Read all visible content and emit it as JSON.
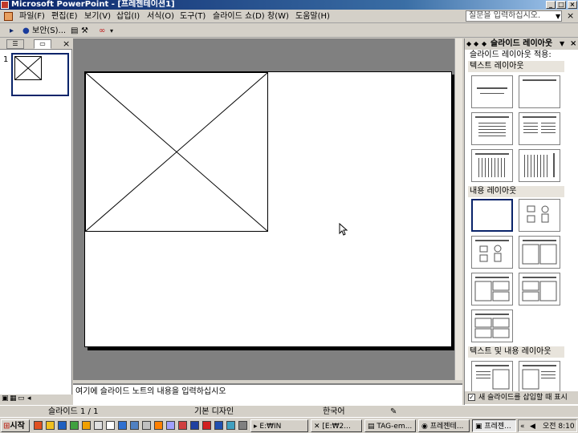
{
  "window": {
    "title": "Microsoft PowerPoint - [프레젠테이션1]",
    "min": "_",
    "max": "□",
    "close": "×"
  },
  "menu": {
    "items": [
      "파일(F)",
      "편집(E)",
      "보기(V)",
      "삽입(I)",
      "서식(O)",
      "도구(T)",
      "슬라이드 쇼(D)",
      "창(W)",
      "도움말(H)"
    ],
    "help_placeholder": "질문을 입력하십시오.",
    "doc_close": "×"
  },
  "toolbar": {
    "security_label": "보안(S)..."
  },
  "left_panel": {
    "tab_outline": "☰",
    "tab_slides": "▭",
    "close": "×",
    "slide_number": "1"
  },
  "notes": {
    "placeholder": "여기에 슬라이드 노트의 내용을 입력하십시오"
  },
  "task_pane": {
    "title": "슬라이드 레이아웃",
    "subtitle": "슬라이드 레이아웃 적용:",
    "close": "×",
    "sections": [
      "텍스트 레이아웃",
      "내용 레이아웃",
      "텍스트 및 내용 레이아웃"
    ],
    "show_on_insert_label": "새 슬라이드를 삽입할 때 표시",
    "show_on_insert_checked": true
  },
  "status": {
    "slide": "슬라이드 1 / 1",
    "design": "기본 디자인",
    "language": "한국어"
  },
  "taskbar": {
    "start": "시작",
    "tasks": [
      "E:₩IN",
      "[E:₩2...",
      "TAG-em...",
      "프레젠테...",
      "프레젠..."
    ],
    "active_task_index": 4,
    "clock": "오전 8:10"
  }
}
